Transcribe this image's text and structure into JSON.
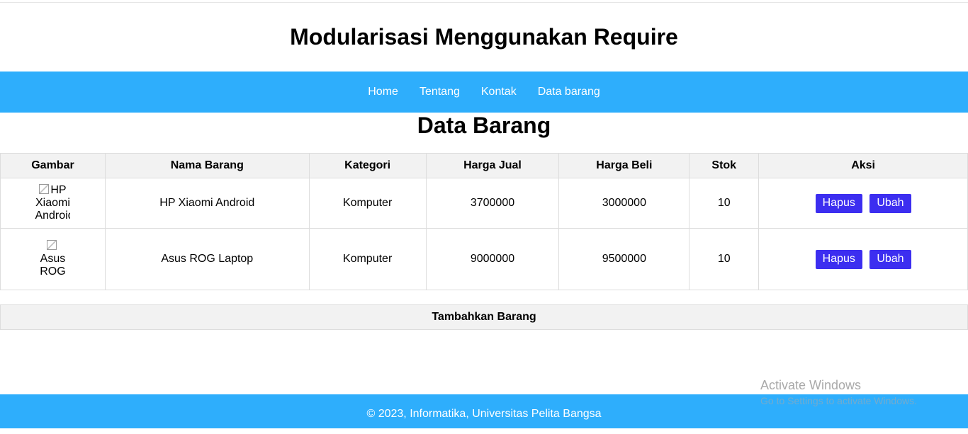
{
  "header": {
    "title": "Modularisasi Menggunakan Require"
  },
  "nav": {
    "items": [
      {
        "label": "Home"
      },
      {
        "label": "Tentang"
      },
      {
        "label": "Kontak"
      },
      {
        "label": "Data barang"
      }
    ]
  },
  "main": {
    "title": "Data Barang",
    "table": {
      "columns": [
        "Gambar",
        "Nama Barang",
        "Kategori",
        "Harga Jual",
        "Harga Beli",
        "Stok",
        "Aksi"
      ],
      "rows": [
        {
          "image_alt": "HP Xiaomi Android",
          "nama": "HP Xiaomi Android",
          "kategori": "Komputer",
          "harga_jual": "3700000",
          "harga_beli": "3000000",
          "stok": "10",
          "hapus_label": "Hapus",
          "ubah_label": "Ubah"
        },
        {
          "image_alt": "Asus ROG",
          "nama": "Asus ROG Laptop",
          "kategori": "Komputer",
          "harga_jual": "9000000",
          "harga_beli": "9500000",
          "stok": "10",
          "hapus_label": "Hapus",
          "ubah_label": "Ubah"
        }
      ]
    },
    "add_label": "Tambahkan Barang"
  },
  "footer": {
    "text": "© 2023, Informatika, Universitas Pelita Bangsa"
  },
  "watermark": {
    "title": "Activate Windows",
    "subtitle": "Go to Settings to activate Windows."
  },
  "colors": {
    "nav_bg": "#2eaefc",
    "button_bg": "#3c2ef0",
    "table_header_bg": "#f2f2f2"
  }
}
